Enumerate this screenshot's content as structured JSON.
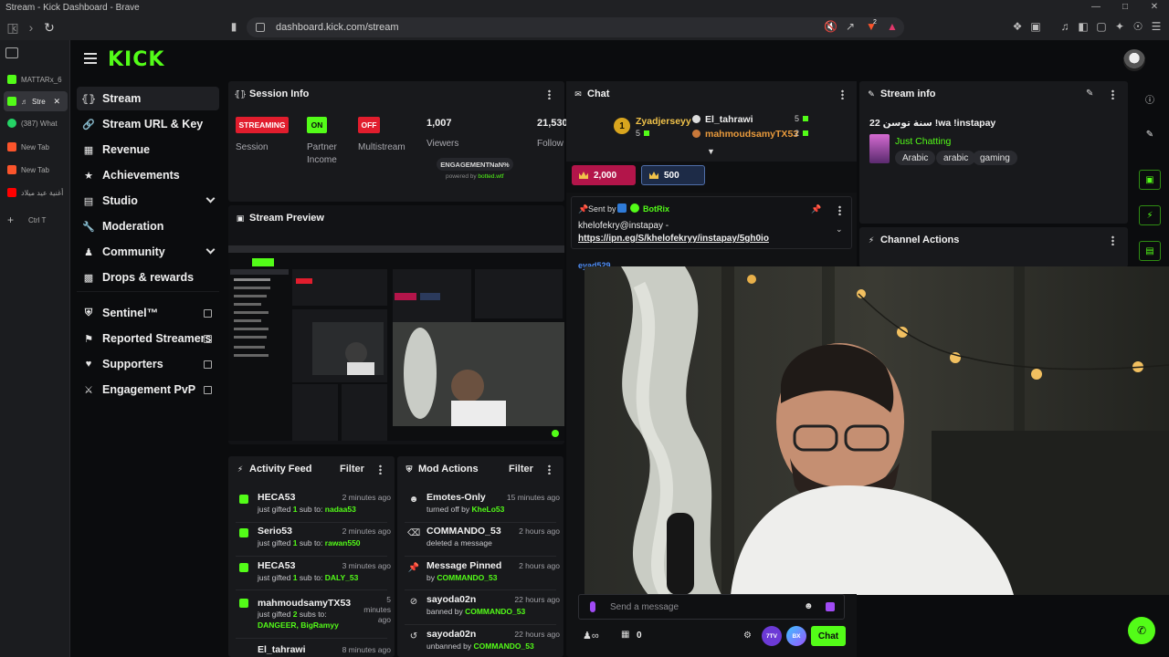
{
  "browser": {
    "window_title": "Stream - Kick Dashboard - Brave",
    "url": "dashboard.kick.com/stream",
    "extension_badge": "2",
    "tabs": [
      {
        "label": "MATTARx_6",
        "favicon": "kick",
        "color": "#53fc18"
      },
      {
        "label": "Stre",
        "favicon": "kick",
        "color": "#53fc18",
        "active": true
      },
      {
        "label": "(387) What",
        "favicon": "whatsapp",
        "color": "#25d366"
      },
      {
        "label": "New Tab",
        "favicon": "brave",
        "color": "#fb542b"
      },
      {
        "label": "New Tab",
        "favicon": "brave",
        "color": "#fb542b"
      },
      {
        "label": "أغنية عيد ميلاد",
        "favicon": "youtube",
        "color": "#ff0000"
      }
    ],
    "new_tab_shortcut": "Ctrl  T"
  },
  "kick": {
    "logo": "KICK",
    "accent": "#53fc18"
  },
  "sidebar": {
    "items": [
      {
        "label": "Stream",
        "icon": "broadcast-icon",
        "active": true
      },
      {
        "label": "Stream URL & Key",
        "icon": "link-icon"
      },
      {
        "label": "Revenue",
        "icon": "revenue-icon"
      },
      {
        "label": "Achievements",
        "icon": "trophy-icon"
      },
      {
        "label": "Studio",
        "icon": "studio-icon",
        "expandable": true
      },
      {
        "label": "Moderation",
        "icon": "wrench-icon"
      },
      {
        "label": "Community",
        "icon": "users-icon",
        "expandable": true
      },
      {
        "label": "Drops & rewards",
        "icon": "chart-icon"
      },
      {
        "label": "Sentinel™",
        "icon": "shield-icon",
        "external": true
      },
      {
        "label": "Reported Streamers",
        "icon": "flag-icon",
        "external": true
      },
      {
        "label": "Supporters",
        "icon": "heart-icon",
        "external": true
      },
      {
        "label": "Engagement PvP",
        "icon": "swords-icon",
        "external": true
      }
    ]
  },
  "session_info": {
    "title": "Session Info",
    "badges": [
      {
        "text": "STREAMING",
        "color": "#e11d2d",
        "label": "Session"
      },
      {
        "text": "ON",
        "color": "#53fc18",
        "label": "Partner Income"
      },
      {
        "text": "OFF",
        "color": "#e11d2d",
        "label": "Multistream"
      }
    ],
    "viewers": {
      "value": "1,007",
      "label": "Viewers"
    },
    "followers": {
      "value": "21,530",
      "label": "Follow"
    },
    "engagement": "ENGAGEMENTNaN%",
    "powered_prefix": "powered by",
    "powered_brand": "botted.wtf"
  },
  "stream_preview": {
    "title": "Stream Preview"
  },
  "chat": {
    "title": "Chat",
    "leaderboard": {
      "rank": "1",
      "user1": "Zyadjerseyy",
      "user1_count": "5",
      "user2": "El_tahrawi",
      "user2_count": "5",
      "user3": "mahmoudsamyTX53",
      "user3_count": "2"
    },
    "goals": [
      {
        "value": "2,000",
        "color": "#b3154a"
      },
      {
        "value": "500",
        "color": "#2b3a5c"
      }
    ],
    "pinned": {
      "sent_by_label": "Sent by",
      "sender": "BotRix",
      "message": "khelofekry@instapay -",
      "link": "https://ipn.eg/S/khelofekryy/instapay/5gh0io"
    },
    "visible_user": "eyad529",
    "composer_placeholder": "Send a message",
    "points": "0",
    "chat_button": "Chat",
    "ttv_label": "7TV",
    "ffz_label": "BX"
  },
  "stream_info": {
    "title": "Stream info",
    "stream_title": "22 سنة توسن !wa !instapay",
    "category": "Just Chatting",
    "tags": [
      "Arabic",
      "arabic",
      "gaming"
    ]
  },
  "channel_actions": {
    "title": "Channel Actions"
  },
  "activity_feed": {
    "title": "Activity Feed",
    "filter": "Filter",
    "items": [
      {
        "name": "HECA53",
        "time": "2 minutes ago",
        "prefix": "just gifted",
        "count": "1",
        "middle": "sub to:",
        "target": "nadaa53"
      },
      {
        "name": "Serio53",
        "time": "2 minutes ago",
        "prefix": "just gifted",
        "count": "1",
        "middle": "sub to:",
        "target": "rawan550"
      },
      {
        "name": "HECA53",
        "time": "3 minutes ago",
        "prefix": "just gifted",
        "count": "1",
        "middle": "sub to:",
        "target": "DALY_53"
      },
      {
        "name": "mahmoudsamyTX53",
        "time": "5 minutes ago",
        "prefix": "just gifted",
        "count": "2",
        "middle": "subs to:",
        "target": "DANGEER, BigRamyy"
      },
      {
        "name": "El_tahrawi",
        "time": "8 minutes ago",
        "prefix": "",
        "count": "",
        "middle": "",
        "target": ""
      }
    ]
  },
  "mod_actions": {
    "title": "Mod Actions",
    "filter": "Filter",
    "items": [
      {
        "icon": "emote-icon",
        "title": "Emotes-Only",
        "time": "15 minutes ago",
        "prefix": "turned off by",
        "actor": "KheLo53"
      },
      {
        "icon": "trash-icon",
        "title": "COMMANDO_53",
        "time": "2 hours ago",
        "prefix": "deleted a message",
        "actor": ""
      },
      {
        "icon": "pin-icon",
        "title": "Message Pinned",
        "time": "2 hours ago",
        "prefix": "by",
        "actor": "COMMANDO_53"
      },
      {
        "icon": "ban-icon",
        "title": "sayoda02n",
        "time": "22 hours ago",
        "prefix": "banned by",
        "actor": "COMMANDO_53"
      },
      {
        "icon": "undo-icon",
        "title": "sayoda02n",
        "time": "22 hours ago",
        "prefix": "unbanned by",
        "actor": "COMMANDO_53"
      }
    ]
  }
}
